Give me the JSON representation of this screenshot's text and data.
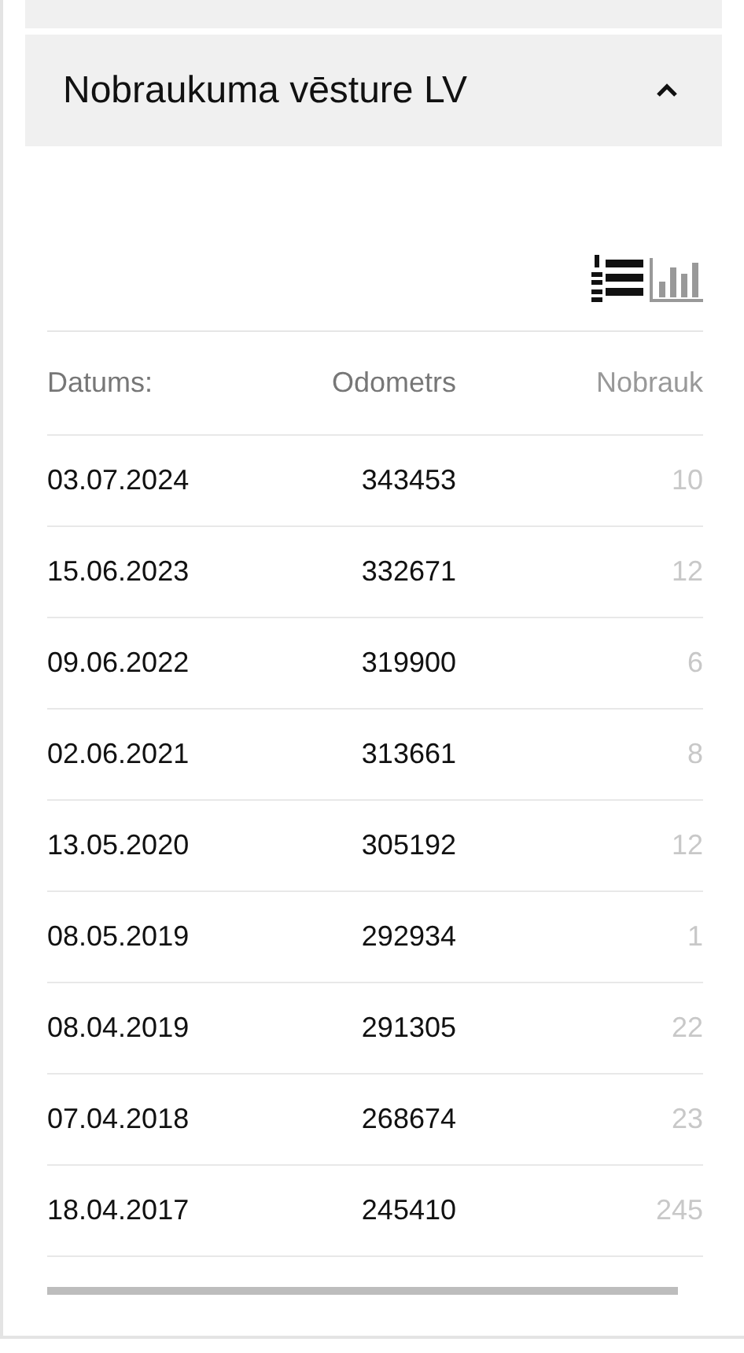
{
  "section": {
    "title": "Nobraukuma vēsture LV",
    "expanded": true
  },
  "table": {
    "columns": [
      "Datums:",
      "Odometrs",
      "Nobrauk"
    ],
    "rows": [
      [
        "03.07.2024",
        "343453",
        "10"
      ],
      [
        "15.06.2023",
        "332671",
        "12"
      ],
      [
        "09.06.2022",
        "319900",
        "6"
      ],
      [
        "02.06.2021",
        "313661",
        "8"
      ],
      [
        "13.05.2020",
        "305192",
        "12"
      ],
      [
        "08.05.2019",
        "292934",
        "1"
      ],
      [
        "08.04.2019",
        "291305",
        "22"
      ],
      [
        "07.04.2018",
        "268674",
        "23"
      ],
      [
        "18.04.2017",
        "245410",
        "245"
      ]
    ]
  }
}
